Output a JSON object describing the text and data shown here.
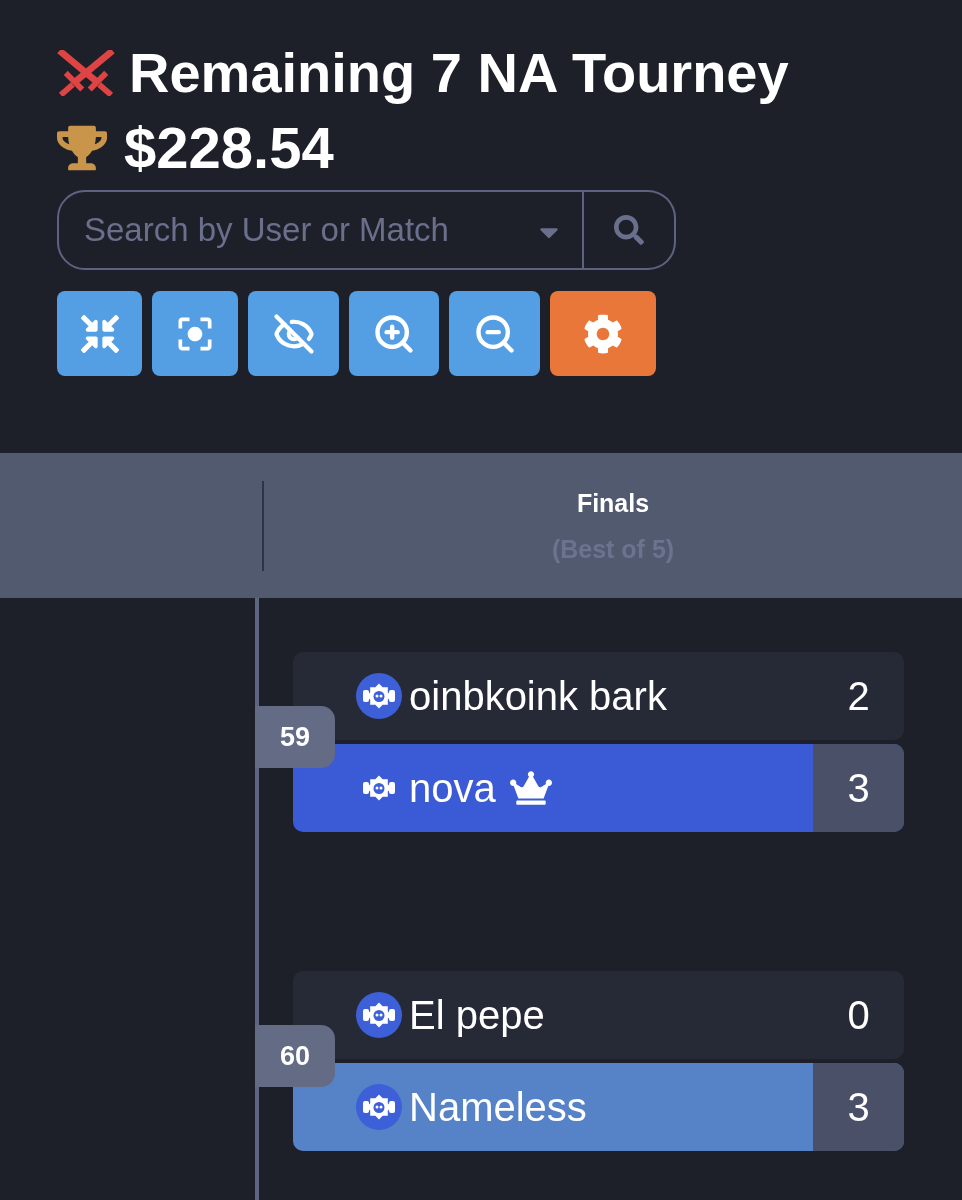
{
  "header": {
    "title": "Remaining 7 NA Tourney",
    "prize": "$228.54"
  },
  "search": {
    "placeholder": "Search by User or Match"
  },
  "toolbar": [
    {
      "kind": "collapse"
    },
    {
      "kind": "focus"
    },
    {
      "kind": "hide"
    },
    {
      "kind": "zoom_in"
    },
    {
      "kind": "zoom_out"
    },
    {
      "kind": "settings"
    }
  ],
  "round": {
    "title": "Finals",
    "subtitle": "(Best of 5)"
  },
  "matches": [
    {
      "number": "59",
      "players": [
        {
          "name": "oinbkoink bark",
          "score": "2",
          "winner": false,
          "highlighted": false,
          "avatar_disc": true,
          "crown": false
        },
        {
          "name": "nova",
          "score": "3",
          "winner": true,
          "highlighted": true,
          "avatar_disc": false,
          "crown": true
        }
      ]
    },
    {
      "number": "60",
      "players": [
        {
          "name": "El pepe",
          "score": "0",
          "winner": false,
          "highlighted": false,
          "avatar_disc": true,
          "crown": false
        },
        {
          "name": "Nameless",
          "score": "3",
          "winner": true,
          "highlighted": false,
          "avatar_disc": true,
          "crown": false
        }
      ]
    }
  ]
}
